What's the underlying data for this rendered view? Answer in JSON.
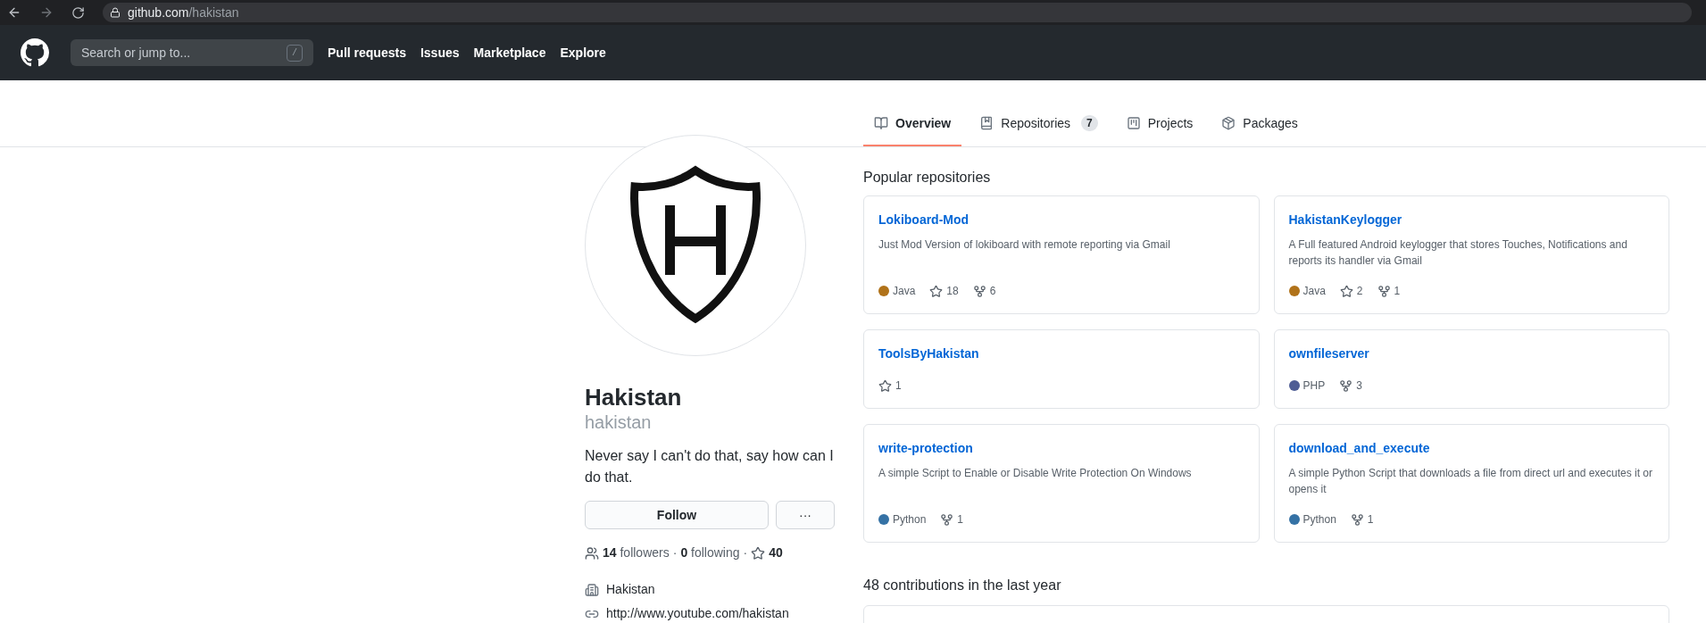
{
  "browser": {
    "url_host": "github.com",
    "url_path": "/hakistan"
  },
  "header": {
    "search_placeholder": "Search or jump to...",
    "search_key": "/",
    "nav": [
      "Pull requests",
      "Issues",
      "Marketplace",
      "Explore"
    ]
  },
  "tabs": [
    {
      "kind": "book",
      "label": "Overview",
      "selected": true
    },
    {
      "kind": "repo",
      "label": "Repositories",
      "count": "7",
      "selected": false
    },
    {
      "kind": "project",
      "label": "Projects",
      "selected": false
    },
    {
      "kind": "package",
      "label": "Packages",
      "selected": false
    }
  ],
  "profile": {
    "name": "Hakistan",
    "username": "hakistan",
    "bio": "Never say I can't do that, say how can I do that.",
    "follow_button": "Follow",
    "more_button": "···",
    "followers": "14",
    "followers_label": "followers",
    "following": "0",
    "following_label": "following",
    "stars": "40",
    "separator": "·",
    "details": [
      {
        "kind": "org",
        "text": "Hakistan"
      },
      {
        "kind": "link",
        "text": "http://www.youtube.com/hakistan"
      }
    ]
  },
  "popular": {
    "title": "Popular repositories",
    "repos": [
      {
        "name": "Lokiboard-Mod",
        "description": "Just Mod Version of lokiboard with remote reporting via Gmail",
        "language": "Java",
        "color": "#b07219",
        "stars": "18",
        "forks": "6"
      },
      {
        "name": "HakistanKeylogger",
        "description": "A Full featured Android keylogger that stores Touches, Notifications and reports its handler via Gmail",
        "language": "Java",
        "color": "#b07219",
        "stars": "2",
        "forks": "1"
      },
      {
        "name": "ToolsByHakistan",
        "stars": "1"
      },
      {
        "name": "ownfileserver",
        "language": "PHP",
        "color": "#4f5d95",
        "forks": "3"
      },
      {
        "name": "write-protection",
        "description": "A simple Script to Enable or Disable Write Protection On Windows",
        "language": "Python",
        "color": "#3572a5",
        "forks": "1"
      },
      {
        "name": "download_and_execute",
        "description": "A simple Python Script that downloads a file from direct url and executes it or opens it",
        "language": "Python",
        "color": "#3572a5",
        "forks": "1"
      }
    ]
  },
  "contributions": {
    "title": "48 contributions in the last year"
  }
}
